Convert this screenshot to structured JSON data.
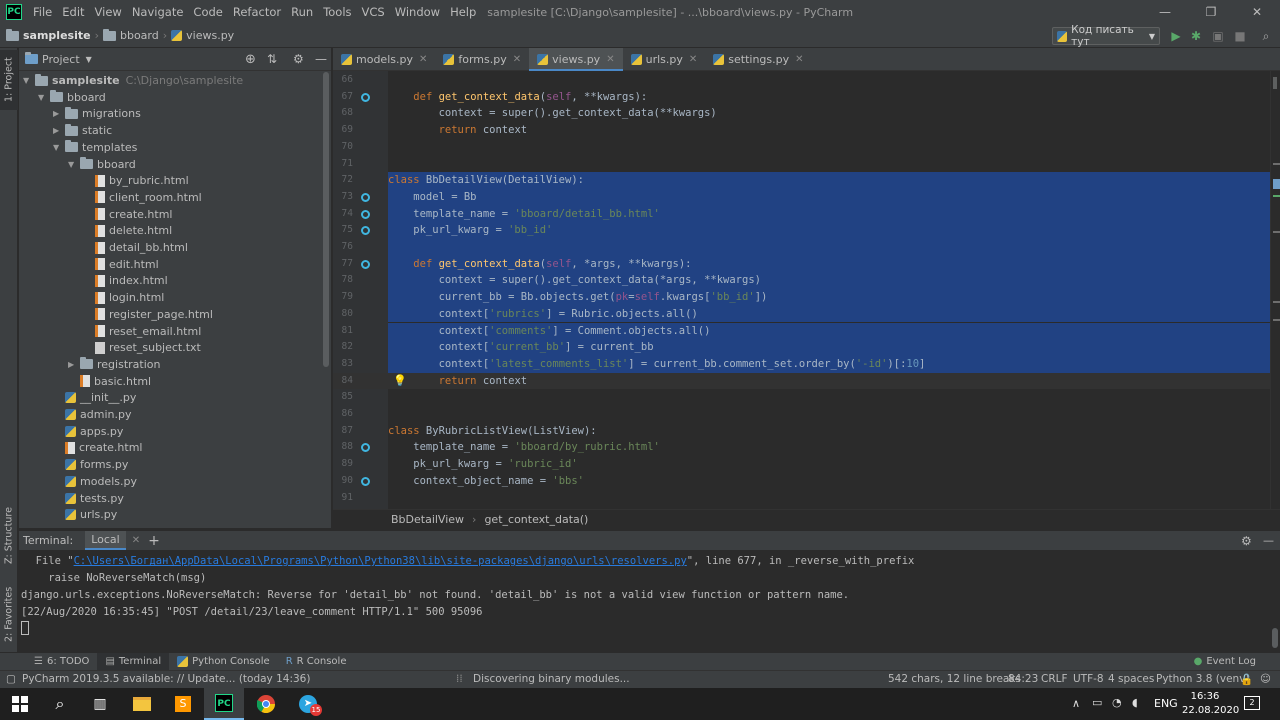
{
  "window": {
    "app_logo": "PC",
    "menu": [
      "File",
      "Edit",
      "View",
      "Navigate",
      "Code",
      "Refactor",
      "Run",
      "Tools",
      "VCS",
      "Window",
      "Help"
    ],
    "title": "samplesite [C:\\Django\\samplesite] - ...\\bboard\\views.py - PyCharm"
  },
  "navbar": {
    "crumbs": [
      "samplesite",
      "bboard",
      "views.py"
    ],
    "run_config": "Код писать тут"
  },
  "left_tabs": {
    "project": "1: Project",
    "structure": "Z: Structure",
    "favorites": "2: Favorites"
  },
  "project": {
    "header": "Project",
    "tree": [
      {
        "label": "samplesite",
        "path": "C:\\Django\\samplesite",
        "type": "folder",
        "arrow": "▼",
        "depth": 0
      },
      {
        "label": "bboard",
        "type": "folder",
        "arrow": "▼",
        "depth": 1
      },
      {
        "label": "migrations",
        "type": "folder",
        "arrow": "▶",
        "depth": 2
      },
      {
        "label": "static",
        "type": "folder",
        "arrow": "▶",
        "depth": 2
      },
      {
        "label": "templates",
        "type": "folder",
        "arrow": "▼",
        "depth": 2
      },
      {
        "label": "bboard",
        "type": "folder",
        "arrow": "▼",
        "depth": 3
      },
      {
        "label": "by_rubric.html",
        "type": "html",
        "depth": 4
      },
      {
        "label": "client_room.html",
        "type": "html",
        "depth": 4
      },
      {
        "label": "create.html",
        "type": "html",
        "depth": 4
      },
      {
        "label": "delete.html",
        "type": "html",
        "depth": 4
      },
      {
        "label": "detail_bb.html",
        "type": "html",
        "depth": 4
      },
      {
        "label": "edit.html",
        "type": "html",
        "depth": 4
      },
      {
        "label": "index.html",
        "type": "html",
        "depth": 4
      },
      {
        "label": "login.html",
        "type": "html",
        "depth": 4
      },
      {
        "label": "register_page.html",
        "type": "html",
        "depth": 4
      },
      {
        "label": "reset_email.html",
        "type": "html",
        "depth": 4
      },
      {
        "label": "reset_subject.txt",
        "type": "txt",
        "depth": 4
      },
      {
        "label": "registration",
        "type": "folder",
        "arrow": "▶",
        "depth": 3
      },
      {
        "label": "basic.html",
        "type": "html",
        "depth": 3
      },
      {
        "label": "__init__.py",
        "type": "py",
        "depth": 2
      },
      {
        "label": "admin.py",
        "type": "py",
        "depth": 2
      },
      {
        "label": "apps.py",
        "type": "py",
        "depth": 2
      },
      {
        "label": "create.html",
        "type": "html",
        "depth": 2
      },
      {
        "label": "forms.py",
        "type": "py",
        "depth": 2
      },
      {
        "label": "models.py",
        "type": "py",
        "depth": 2
      },
      {
        "label": "tests.py",
        "type": "py",
        "depth": 2
      },
      {
        "label": "urls.py",
        "type": "py",
        "depth": 2
      }
    ]
  },
  "editor_tabs": [
    {
      "label": "models.py",
      "active": false
    },
    {
      "label": "forms.py",
      "active": false
    },
    {
      "label": "views.py",
      "active": true
    },
    {
      "label": "urls.py",
      "active": false
    },
    {
      "label": "settings.py",
      "active": false
    }
  ],
  "code": [
    {
      "n": "66",
      "html": "",
      "sel": false
    },
    {
      "n": "67",
      "html": "    <span class='kw'>def</span> <span class='fn'>get_context_data</span>(<span class='slf'>self</span>, **kwargs):",
      "sel": false,
      "icon": true
    },
    {
      "n": "68",
      "html": "        context = <span class='fn2'>super</span>().get_context_data(**kwargs)",
      "sel": false
    },
    {
      "n": "69",
      "html": "        <span class='kw'>return</span> context",
      "sel": false
    },
    {
      "n": "70",
      "html": "",
      "sel": false
    },
    {
      "n": "71",
      "html": "",
      "sel": false
    },
    {
      "n": "72",
      "html": "<span class='kw'>class</span> BbDetailView(DetailView):",
      "sel": true
    },
    {
      "n": "73",
      "html": "    model = Bb",
      "sel": true,
      "icon": true
    },
    {
      "n": "74",
      "html": "    template_name = <span class='str'>'bboard/detail_bb.html'</span>",
      "sel": true,
      "icon": true
    },
    {
      "n": "75",
      "html": "    pk_url_kwarg = <span class='str'>'bb_id'</span>",
      "sel": true,
      "icon": true
    },
    {
      "n": "76",
      "html": "",
      "sel": true
    },
    {
      "n": "77",
      "html": "    <span class='kw'>def</span> <span class='fn'>get_context_data</span>(<span class='slf'>self</span>, *args, **kwargs):",
      "sel": true,
      "icon": true
    },
    {
      "n": "78",
      "html": "        context = super().get_context_data(*args, **kwargs)",
      "sel": true
    },
    {
      "n": "79",
      "html": "        current_bb = Bb.objects.get(<span class='slf'>pk</span>=<span class='slf'>self</span>.kwargs[<span class='str'>'bb_id'</span>])",
      "sel": true
    },
    {
      "n": "80",
      "html": "        context[<span class='str'>'rubrics'</span>] = Rubric.objects.all()",
      "sel": true
    },
    {
      "n": "81",
      "html": "        context[<span class='str'>'comments'</span>] = Comment.objects.all()",
      "sel": true
    },
    {
      "n": "82",
      "html": "        context[<span class='str'>'current_bb'</span>] = current_bb",
      "sel": true
    },
    {
      "n": "83",
      "html": "        context[<span class='str'>'latest_comments_list'</span>] = current_bb.comment_set.order_by(<span class='str'>'-id'</span>)[:<span class='num'>10</span>]",
      "sel": true
    },
    {
      "n": "84",
      "html": "        <span class='kw'>return</span> context",
      "sel": false,
      "caret": true,
      "bulb": true
    },
    {
      "n": "85",
      "html": "",
      "sel": false
    },
    {
      "n": "86",
      "html": "",
      "sel": false
    },
    {
      "n": "87",
      "html": "<span class='kw'>class</span> ByRubricListView(ListView):",
      "sel": false
    },
    {
      "n": "88",
      "html": "    template_name = <span class='str'>'bboard/by_rubric.html'</span>",
      "sel": false,
      "icon": true
    },
    {
      "n": "89",
      "html": "    pk_url_kwarg = <span class='str'>'rubric_id'</span>",
      "sel": false
    },
    {
      "n": "90",
      "html": "    context_object_name = <span class='str'>'bbs'</span>",
      "sel": false,
      "icon": true
    },
    {
      "n": "91",
      "html": "",
      "sel": false
    }
  ],
  "breadcrumbs": [
    "BbDetailView",
    "get_context_data()"
  ],
  "terminal": {
    "label": "Terminal:",
    "tab": "Local",
    "add": "+",
    "lines": [
      {
        "pre": "  File \"",
        "link": "C:\\Users\\Богдан\\AppData\\Local\\Programs\\Python\\Python38\\lib\\site-packages\\django\\urls\\resolvers.py",
        "post": "\", line 677, in _reverse_with_prefix"
      },
      {
        "pre": "    raise NoReverseMatch(msg)",
        "link": "",
        "post": ""
      },
      {
        "pre": "django.urls.exceptions.NoReverseMatch: Reverse for 'detail_bb' not found. 'detail_bb' is not a valid view function or pattern name.",
        "link": "",
        "post": ""
      },
      {
        "pre": "[22/Aug/2020 16:35:45] \"POST /detail/23/leave_comment HTTP/1.1\" 500 95096",
        "link": "",
        "post": ""
      }
    ]
  },
  "bottom_tools": [
    "6: TODO",
    "Terminal",
    "Python Console",
    "R Console"
  ],
  "event_log": "Event Log",
  "status": {
    "update": "PyCharm 2019.3.5 available: // Update... (today 14:36)",
    "task": "Discovering binary modules...",
    "chars": "542 chars, 12 line breaks",
    "pos": "84:23",
    "crlf": "CRLF",
    "enc": "UTF-8",
    "indent": "4 spaces",
    "interp": "Python 3.8 (venv)"
  },
  "taskbar": {
    "lang": "ENG",
    "time": "16:36",
    "date": "22.08.2020",
    "badge": "15",
    "notif": "2"
  },
  "colors": {
    "accent": "#4a88c7",
    "selection": "#214283"
  }
}
